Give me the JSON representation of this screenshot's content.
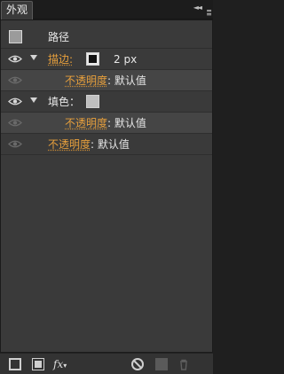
{
  "panel": {
    "tab_title": "外观",
    "collapse_glyph": "◄◄",
    "menu_glyph": "≡"
  },
  "header": {
    "title": "路径"
  },
  "rows": {
    "stroke": {
      "label": "描边",
      "colon": ":",
      "width": "2 px"
    },
    "stroke_opacity": {
      "label": "不透明度",
      "colon": ":",
      "value": "默认值"
    },
    "fill": {
      "label": "填色",
      "colon": "："
    },
    "fill_opacity": {
      "label": "不透明度",
      "colon": ":",
      "value": "默认值"
    },
    "opacity": {
      "label": "不透明度",
      "colon": ":",
      "value": "默认值"
    }
  },
  "toolbar": {
    "fx_label": "fx",
    "fx_dropdown": "▾",
    "icons": [
      "new-stroke-icon",
      "new-fill-icon",
      "fx-icon",
      "clear-appearance-icon",
      "duplicate-item-icon",
      "delete-item-icon"
    ]
  },
  "colors": {
    "accent_link": "#e8a03c",
    "panel_bg": "#3a3a3a",
    "row_alt_bg": "#454545"
  }
}
